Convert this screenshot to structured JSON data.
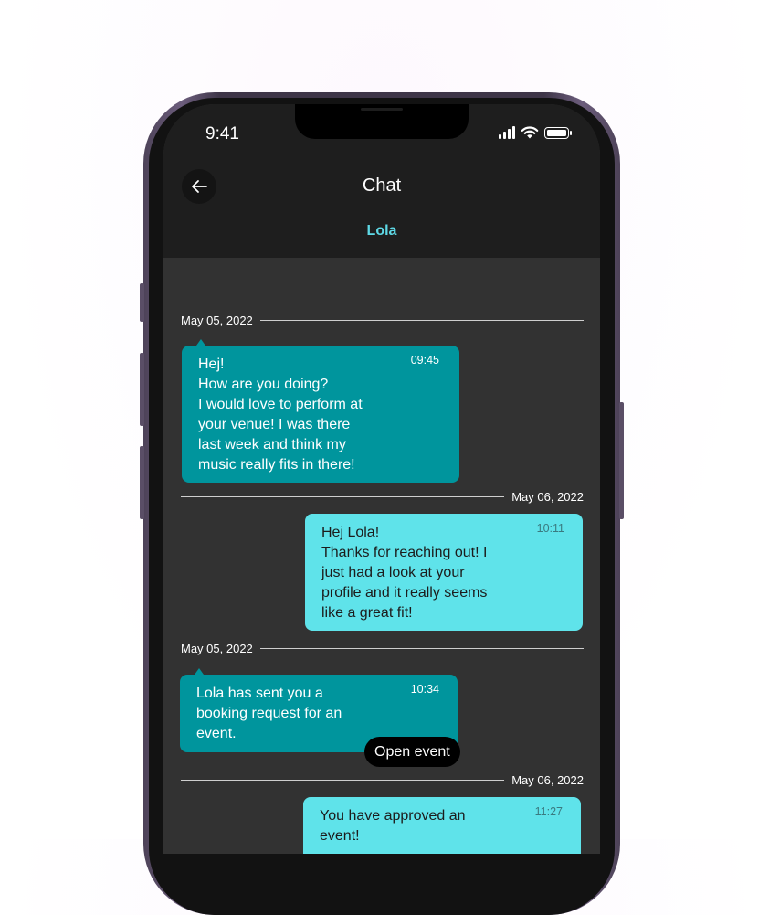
{
  "status_bar": {
    "time": "9:41"
  },
  "header": {
    "title": "Chat",
    "contact_name": "Lola"
  },
  "messages": [
    {
      "date": "May 05, 2022",
      "direction": "incoming",
      "time": "09:45",
      "text": "Hej!\nHow are you doing?\nI would love to perform at\nyour venue! I was there\nlast week and think my\nmusic really fits in there!"
    },
    {
      "date": "May 06, 2022",
      "direction": "outgoing",
      "time": "10:11",
      "text": "Hej Lola!\nThanks for reaching out! I\njust had a look at your\nprofile and it really seems\nlike a great fit!"
    },
    {
      "date": "May 05, 2022",
      "direction": "incoming",
      "time": "10:34",
      "text": "Lola has sent you a\nbooking request for an\nevent.",
      "action_label": "Open event"
    },
    {
      "date": "May 06, 2022",
      "direction": "outgoing",
      "time": "11:27",
      "text": "You have approved an\nevent!"
    }
  ],
  "colors": {
    "incoming_bubble": "#00959d",
    "outgoing_bubble": "#5fe3ea",
    "accent": "#5ed9e6",
    "screen_bg": "#323232",
    "header_bg": "#1e1e1e"
  },
  "icons": {
    "back": "arrow-left-icon",
    "signal": "cellular-signal-icon",
    "wifi": "wifi-icon",
    "battery": "battery-icon"
  }
}
